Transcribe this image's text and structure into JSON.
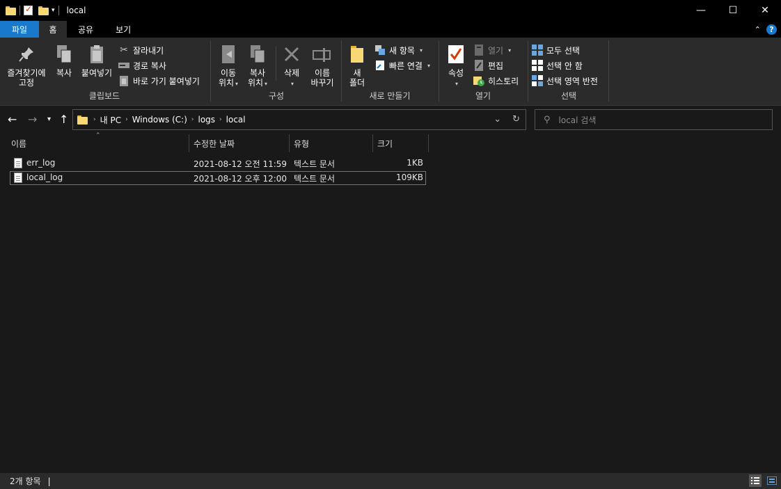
{
  "window": {
    "title": "local",
    "minimize_glyph": "—",
    "maximize_glyph": "☐",
    "close_glyph": "✕"
  },
  "tabs": {
    "file": "파일",
    "home": "홈",
    "share": "공유",
    "view": "보기"
  },
  "ribbon": {
    "clipboard": {
      "label": "클립보드",
      "pin": "즐겨찾기에\n고정",
      "copy": "복사",
      "paste": "붙여넣기",
      "cut": "잘라내기",
      "copy_path": "경로 복사",
      "paste_shortcut": "바로 가기 붙여넣기"
    },
    "organize": {
      "label": "구성",
      "move_to": "이동\n위치",
      "copy_to": "복사\n위치",
      "delete": "삭제",
      "rename": "이름\n바꾸기"
    },
    "new": {
      "label": "새로 만들기",
      "new_folder": "새\n폴더",
      "new_item": "새 항목",
      "easy_access": "빠른 연결"
    },
    "open": {
      "label": "열기",
      "properties": "속성",
      "open": "열기",
      "edit": "편집",
      "history": "히스토리"
    },
    "select": {
      "label": "선택",
      "select_all": "모두 선택",
      "select_none": "선택 안 함",
      "invert": "선택 영역 반전"
    }
  },
  "address": {
    "crumbs": [
      "내 PC",
      "Windows (C:)",
      "logs",
      "local"
    ]
  },
  "search": {
    "placeholder": "local 검색"
  },
  "columns": {
    "name": "이름",
    "modified": "수정한 날짜",
    "type": "유형",
    "size": "크기"
  },
  "files": [
    {
      "name": "err_log",
      "modified": "2021-08-12 오전 11:59",
      "type": "텍스트 문서",
      "size": "1KB",
      "selected": false
    },
    {
      "name": "local_log",
      "modified": "2021-08-12 오후 12:00",
      "type": "텍스트 문서",
      "size": "109KB",
      "selected": true
    }
  ],
  "status": {
    "count": "2개 항목"
  },
  "colors": {
    "accent": "#1979ca",
    "folder": "#f8d775",
    "background": "#191919",
    "ribbon": "#2b2b2b"
  }
}
